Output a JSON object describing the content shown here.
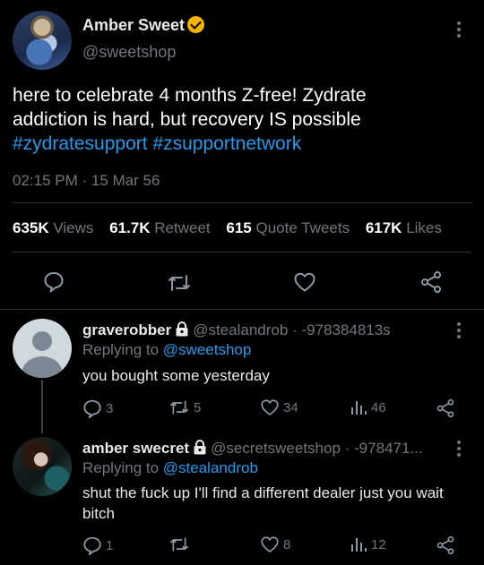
{
  "main_tweet": {
    "author_name": "Amber Sweet",
    "author_handle": "@sweetshop",
    "text_line1": "here to celebrate 4 months Z-free! Zydrate",
    "text_line2": "addiction is hard, but recovery IS possible",
    "hashtag1": "#zydratesupport",
    "hashtag2": "#zsupportnetwork",
    "timestamp": "02:15 PM · 15 Mar 56",
    "stats": {
      "views_count": "635K",
      "views_label": "Views",
      "retweets_count": "61.7K",
      "retweets_label": "Retweet",
      "quotes_count": "615",
      "quotes_label": "Quote Tweets",
      "likes_count": "617K",
      "likes_label": "Likes"
    }
  },
  "replies": [
    {
      "author_name": "graverobber",
      "author_handle": "@stealandrob",
      "time": "· -978384813s",
      "replying_prefix": "Replying to",
      "replying_handle": "@sweetshop",
      "text": "you bought some yesterday",
      "replies": "3",
      "retweets": "5",
      "likes": "34",
      "views": "46"
    },
    {
      "author_name": "amber swecret",
      "author_handle": "@secretsweetshop",
      "time": "· -978471...",
      "replying_prefix": "Replying to",
      "replying_handle": "@stealandrob",
      "text": "shut the fuck up I'll find a different dealer just you wait bitch",
      "replies": "1",
      "retweets": "",
      "likes": "8",
      "views": "12"
    }
  ],
  "icons": {
    "verified": "verified-badge-icon",
    "more": "more-vertical-icon",
    "reply": "reply-bubble-icon",
    "retweet": "retweet-icon",
    "like": "heart-icon",
    "share": "share-icon",
    "views": "views-bar-icon",
    "lock": "lock-icon"
  },
  "colors": {
    "background": "#000000",
    "text": "#e7e9ea",
    "muted": "#71767b",
    "link": "#1d9bf0",
    "verified": "#f4b400"
  }
}
